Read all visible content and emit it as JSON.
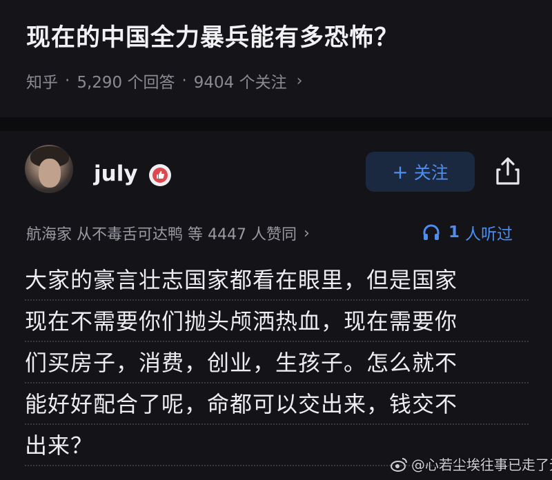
{
  "question": {
    "title": "现在的中国全力暴兵能有多恐怖？",
    "source": "知乎",
    "answers": "5,290 个回答",
    "followers": "9404 个关注",
    "chevron": "›"
  },
  "answer": {
    "author": "july",
    "badge_icon": "like-badge-icon",
    "follow_label": "关注",
    "follow_plus": "+",
    "upvote_text": "航海家 从不毒舌可达鸭 等 4447 人赞同",
    "upvote_chevron": "›",
    "listen_count": "1",
    "listen_label": "人听过",
    "content_lines": [
      "大家的豪言壮志国家都看在眼里，但是国家",
      "现在不需要你们抛头颅洒热血，现在需要你",
      "们买房子，消费，创业，生孩子。怎么就不",
      "能好好配合了呢，命都可以交出来，钱交不",
      "出来？"
    ]
  },
  "watermark": {
    "text": "@心若尘埃往事已走了无痕"
  },
  "colors": {
    "background": "#121216",
    "accent": "#4d8ef0",
    "follow_bg": "#1b2940",
    "text_primary": "#eeeef1",
    "text_secondary": "#8a8a92"
  }
}
